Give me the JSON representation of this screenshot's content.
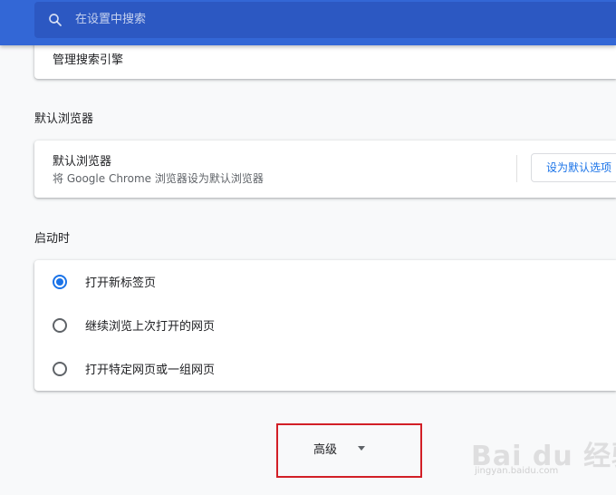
{
  "search": {
    "placeholder": "在设置中搜索",
    "icon": "search-icon"
  },
  "search_engine": {
    "manage_label": "管理搜索引擎"
  },
  "default_browser": {
    "section_title": "默认浏览器",
    "row_title": "默认浏览器",
    "row_subtitle": "将 Google Chrome 浏览器设为默认浏览器",
    "button_label": "设为默认选项"
  },
  "startup": {
    "section_title": "启动时",
    "options": [
      {
        "label": "打开新标签页",
        "checked": true
      },
      {
        "label": "继续浏览上次打开的网页",
        "checked": false
      },
      {
        "label": "打开特定网页或一组网页",
        "checked": false
      }
    ]
  },
  "advanced": {
    "label": "高级",
    "icon": "chevron-down-icon"
  },
  "watermark": {
    "main": "Bai du 经验",
    "sub": "jingyan.baidu.com"
  },
  "colors": {
    "header": "#3367d6",
    "search_field": "#2c58c2",
    "accent": "#1a73e8",
    "highlight_border": "#d21f26",
    "background": "#f8f9fa"
  }
}
